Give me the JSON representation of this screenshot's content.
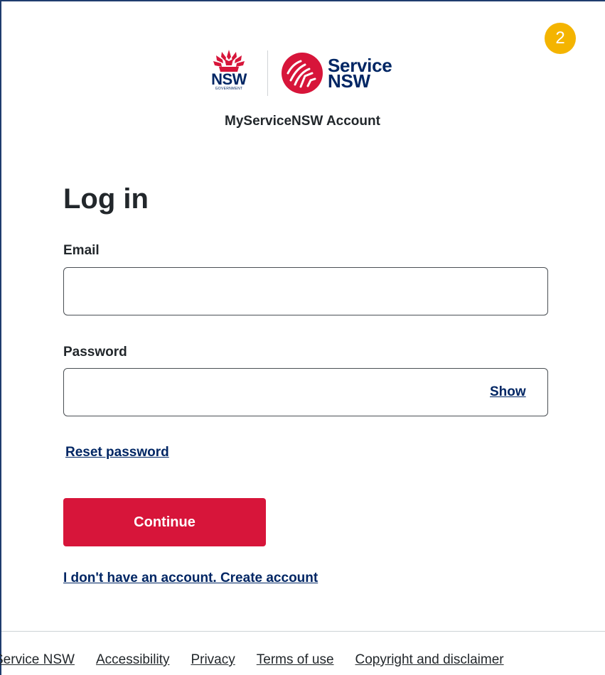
{
  "step_badge": "2",
  "header": {
    "nsw_logo_text": "NSW",
    "nsw_logo_subtext": "GOVERNMENT",
    "service_logo_line1": "Service",
    "service_logo_line2": "NSW",
    "account_title": "MyServiceNSW Account"
  },
  "form": {
    "heading": "Log in",
    "email_label": "Email",
    "email_value": "",
    "password_label": "Password",
    "password_value": "",
    "show_label": "Show",
    "reset_password_label": "Reset password",
    "continue_label": "Continue",
    "create_account_label": "I don't have an account. Create account"
  },
  "footer": {
    "links": [
      "Service NSW",
      "Accessibility",
      "Privacy",
      "Terms of use",
      "Copyright and disclaimer"
    ]
  },
  "colors": {
    "primary_red": "#d7153a",
    "navy": "#002664",
    "badge": "#f4b400"
  }
}
